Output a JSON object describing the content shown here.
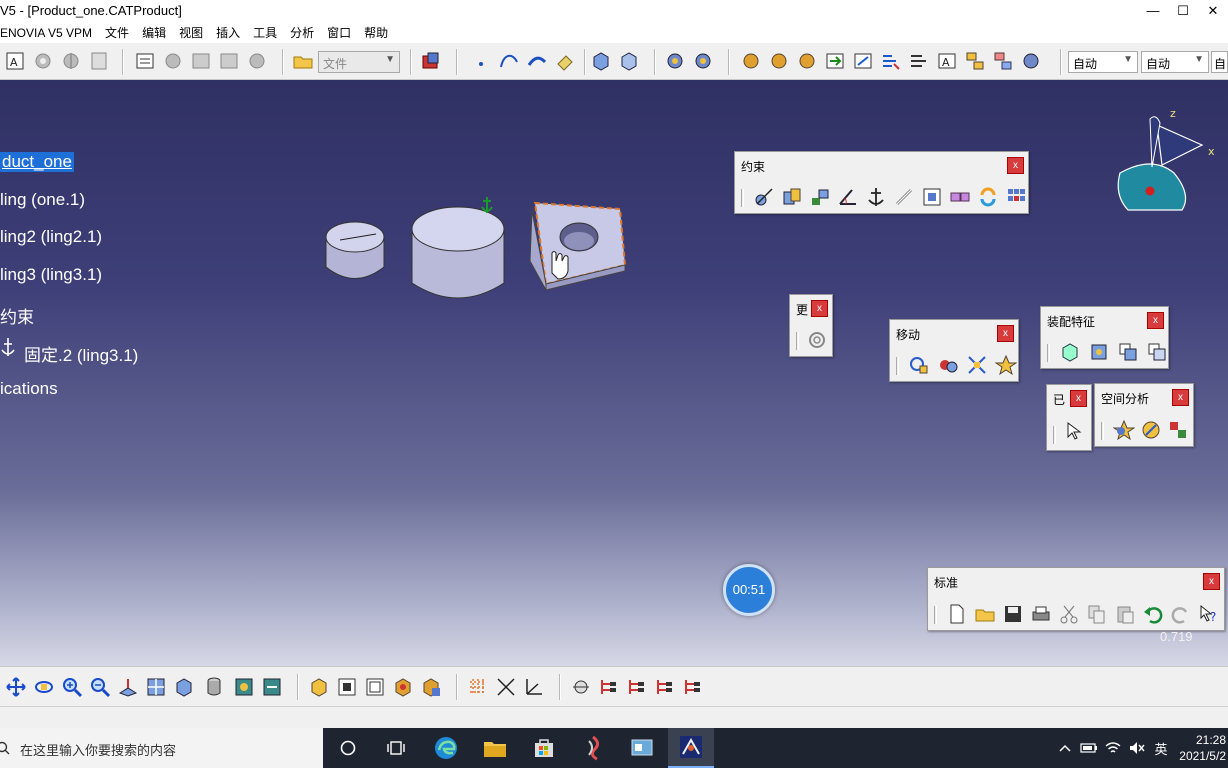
{
  "window": {
    "title": "V5 - [Product_one.CATProduct]",
    "controls": [
      "—",
      "☐",
      "✕"
    ]
  },
  "menu": [
    "ENOVIA V5 VPM",
    "文件",
    "编辑",
    "视图",
    "插入",
    "工具",
    "分析",
    "窗口",
    "帮助"
  ],
  "top_toolbar": {
    "file_combo": "文件",
    "combo_1": "自动",
    "combo_2": "自动",
    "combo_3": "自"
  },
  "tree": [
    "duct_one",
    "ling (one.1)",
    "ling2 (ling2.1)",
    "ling3 (ling3.1)",
    "约束",
    "固定.2 (ling3.1)",
    "ications"
  ],
  "compass": {
    "z_label": "z",
    "x_label": "x"
  },
  "panels": {
    "constraints": {
      "title": "约束",
      "close": "x"
    },
    "more": {
      "title": "更",
      "close": "x"
    },
    "move": {
      "title": "移动",
      "close": "x"
    },
    "assembly_features": {
      "title": "装配特征",
      "close": "x"
    },
    "applied": {
      "title": "已",
      "close": "x"
    },
    "space_analysis": {
      "title": "空间分析",
      "close": "x"
    },
    "standard": {
      "title": "标准",
      "close": "x"
    }
  },
  "timer": "00:51",
  "scale_readout": "0.719",
  "taskbar": {
    "search_placeholder": "在这里输入你要搜索的内容",
    "ime": "英",
    "time": "21:28",
    "date": "2021/5/2"
  },
  "colors": {
    "selection": "#1f6fd8",
    "viewport_top": "#2f3063",
    "viewport_bottom": "#d6d8e6",
    "part": "#c7c8e8",
    "highlight": "#e0762b"
  }
}
